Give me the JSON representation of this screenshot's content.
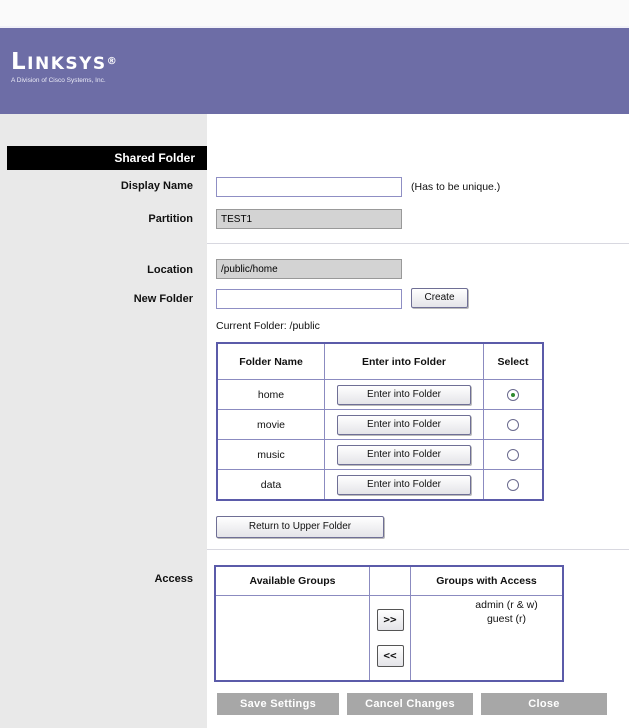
{
  "brand": {
    "name": "Linksys",
    "subtitle": "A Division of Cisco Systems, Inc."
  },
  "section_title": "Shared Folder",
  "labels": {
    "display_name": "Display Name",
    "partition": "Partition",
    "location": "Location",
    "new_folder": "New Folder",
    "access": "Access"
  },
  "fields": {
    "display_name": {
      "value": "",
      "note": "(Has to be unique.)"
    },
    "partition": {
      "value": "TEST1"
    },
    "location": {
      "value": "/public/home"
    },
    "new_folder": {
      "value": ""
    }
  },
  "buttons": {
    "create": "Create",
    "return_upper": "Return to Upper Folder",
    "add": ">>",
    "remove": "<<"
  },
  "current_folder": "Current Folder: /public",
  "folder_table": {
    "headers": [
      "Folder Name",
      "Enter into Folder",
      "Select"
    ],
    "rows": [
      {
        "name": "home",
        "action": "Enter into Folder",
        "selected": true
      },
      {
        "name": "movie",
        "action": "Enter into Folder",
        "selected": false
      },
      {
        "name": "music",
        "action": "Enter into Folder",
        "selected": false
      },
      {
        "name": "data",
        "action": "Enter into Folder",
        "selected": false
      }
    ]
  },
  "access_table": {
    "headers": [
      "Available Groups",
      "",
      "Groups with Access"
    ],
    "available": [],
    "with_access": [
      "admin (r & w)",
      "guest (r)"
    ]
  },
  "footer": {
    "save": "Save Settings",
    "cancel": "Cancel Changes",
    "close": "Close"
  },
  "colors": {
    "header": "#6d6da6",
    "left_panel": "#e9e9e9",
    "table_border": "#5b5ba9",
    "footer_button": "#a7a7a7"
  }
}
